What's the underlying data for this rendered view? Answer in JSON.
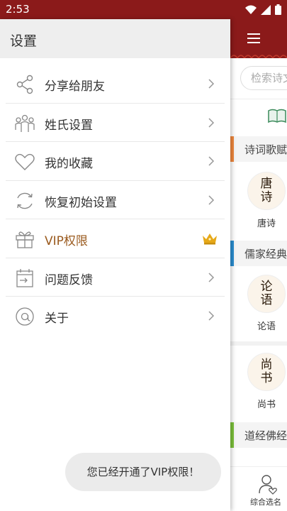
{
  "status_bar": {
    "time": "2:53",
    "icons": [
      "wifi-icon",
      "signal-icon",
      "battery-icon"
    ]
  },
  "colors": {
    "brand": "#8b1a1a",
    "vip": "#9a5a1e",
    "crown": "#e6a817",
    "poetry_bar": "#f0883e",
    "confucian_bar": "#2b8fd1",
    "daoist_bar": "#7cc23b"
  },
  "drawer": {
    "title": "设置",
    "items": [
      {
        "label": "分享给朋友",
        "icon": "share-icon"
      },
      {
        "label": "姓氏设置",
        "icon": "people-icon"
      },
      {
        "label": "我的收藏",
        "icon": "heart-icon"
      },
      {
        "label": "恢复初始设置",
        "icon": "refresh-icon"
      },
      {
        "label": "VIP权限",
        "icon": "gift-icon",
        "badge": "crown-icon"
      },
      {
        "label": "问题反馈",
        "icon": "feedback-icon"
      },
      {
        "label": "关于",
        "icon": "at-icon"
      }
    ]
  },
  "background_app": {
    "search_placeholder": "检索诗文",
    "sections": [
      {
        "label": "诗词歌赋"
      },
      {
        "label": "儒家经典"
      },
      {
        "label": "道经佛经"
      }
    ],
    "books": [
      {
        "name": "唐诗",
        "glyph": "唐诗"
      },
      {
        "name": "论语",
        "glyph": "论语"
      },
      {
        "name": "尚书",
        "glyph": "尚书"
      }
    ],
    "bottom_tab": "综合选名"
  },
  "toast": "您已经开通了VIP权限！"
}
